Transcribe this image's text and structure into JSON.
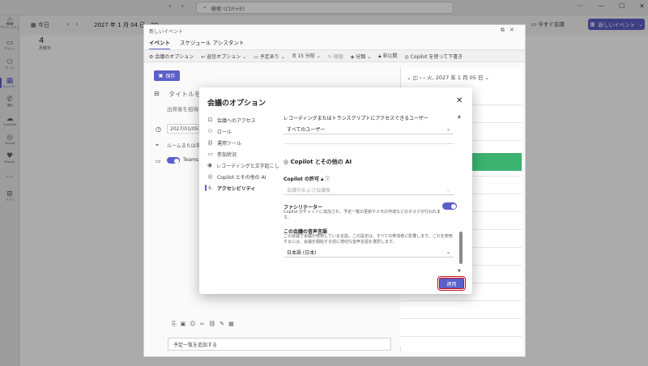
{
  "titlebar": {
    "search_placeholder": "検索 (Ctrl+E)"
  },
  "rail": {
    "items": [
      {
        "label": "アクティビティ",
        "icon": "bell-icon"
      },
      {
        "label": "チャット",
        "icon": "chat-icon"
      },
      {
        "label": "チーム",
        "icon": "teams-icon"
      },
      {
        "label": "カレンダー",
        "icon": "calendar-icon"
      },
      {
        "label": "通話",
        "icon": "phone-icon"
      },
      {
        "label": "OneDrive",
        "icon": "cloud-icon"
      },
      {
        "label": "Copilot",
        "icon": "copilot-icon"
      },
      {
        "label": "Planner",
        "icon": "planner-icon"
      },
      {
        "label": "",
        "icon": "more-icon"
      },
      {
        "label": "アプリ",
        "icon": "apps-icon"
      }
    ]
  },
  "calendar": {
    "today": "今日",
    "range": "2027 年 1 月 04 日 - 08",
    "meet_now": "今すぐ会議",
    "new_event": "新しいイベント",
    "day_num": "4",
    "day_name": "月曜日"
  },
  "event": {
    "window_title": "新しいイベント",
    "tabs": [
      "イベント",
      "スケジュール アシスタント"
    ],
    "toolbar": [
      "会議のオプション",
      "返信オプション",
      "予定あり",
      "15 分前",
      "稼働",
      "分類",
      "非公開",
      "Copilot を使って下書き"
    ],
    "save": "保存",
    "title_placeholder": "タイトルを追加",
    "attendees_placeholder": "出席者を招待する",
    "date": "2027/01/05",
    "location": "ルームまたは場所",
    "teams": "Teams",
    "right_date": "火, 2027 年 1 月 05 日",
    "bottom_field": "予定一覧を追加する"
  },
  "modal": {
    "title": "会議のオプション",
    "nav": [
      {
        "label": "会議へのアクセス",
        "icon": "access-icon",
        "active": false
      },
      {
        "label": "ロール",
        "icon": "role-icon",
        "active": false
      },
      {
        "label": "運用ツール",
        "icon": "tools-icon",
        "active": false
      },
      {
        "label": "参加状況",
        "icon": "engagement-icon",
        "active": false
      },
      {
        "label": "レコーディングと文字起こし",
        "icon": "record-icon",
        "active": false
      },
      {
        "label": "Copilot とその他の AI",
        "icon": "copilot-icon",
        "active": false
      },
      {
        "label": "アクセシビリティ",
        "icon": "accessibility-icon",
        "active": true
      }
    ],
    "recording_access_label": "レコーディングまたはトランスクリプトにアクセスできるユーザー",
    "recording_access_value": "すべてのユーザー",
    "copilot_section": "Copilot とその他の AI",
    "copilot_permission_label": "Copilot の許可",
    "copilot_permission_value": "会議中および会議後",
    "facilitator_label": "ファシリテーター",
    "facilitator_desc": "Copilot がチャットに追加され、予定一覧の更新やメモの作成などのタスクが行われます。",
    "facilitator_on": true,
    "language_label": "この会議の音声言語",
    "language_desc": "この会議で会議が使用している言語。この設定は、すべての参加者に影響します。これを使用するには、会議を開始する前に適切な音声言語を選択します。",
    "language_value": "日本語 (日本)",
    "apply": "適用"
  },
  "colors": {
    "accent": "#5b5fc7",
    "highlight": "#c50f1f",
    "green": "#3cb371"
  }
}
